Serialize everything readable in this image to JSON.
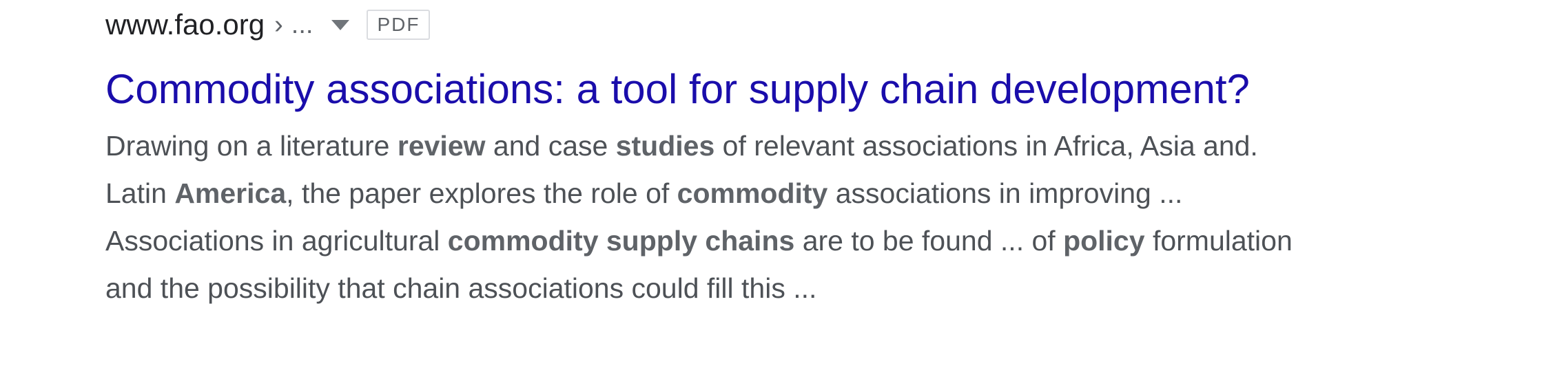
{
  "result": {
    "cite": {
      "domain": "www.fao.org",
      "separator": "›",
      "path": "...",
      "dropdown_icon": "chevron-down-icon",
      "file_type": "PDF"
    },
    "title": "Commodity associations: a tool for supply chain development?",
    "snippet_lines": [
      [
        {
          "text": "Drawing on a literature ",
          "bold": false
        },
        {
          "text": "review",
          "bold": true
        },
        {
          "text": " and case ",
          "bold": false
        },
        {
          "text": "studies",
          "bold": true
        },
        {
          "text": " of relevant associations in Africa, Asia and.",
          "bold": false
        }
      ],
      [
        {
          "text": "Latin ",
          "bold": false
        },
        {
          "text": "America",
          "bold": true
        },
        {
          "text": ", the paper explores the role of ",
          "bold": false
        },
        {
          "text": "commodity",
          "bold": true
        },
        {
          "text": " associations in improving ...",
          "bold": false
        }
      ],
      [
        {
          "text": "Associations in agricultural ",
          "bold": false
        },
        {
          "text": "commodity supply chains",
          "bold": true
        },
        {
          "text": " are to be found ... of ",
          "bold": false
        },
        {
          "text": "policy",
          "bold": true
        },
        {
          "text": " formulation",
          "bold": false
        }
      ],
      [
        {
          "text": "and the possibility that chain associations could fill this ...",
          "bold": false
        }
      ]
    ],
    "colors": {
      "title_link": "#1a0dab",
      "snippet_text": "#4d5156",
      "cite_text": "#202124"
    }
  }
}
